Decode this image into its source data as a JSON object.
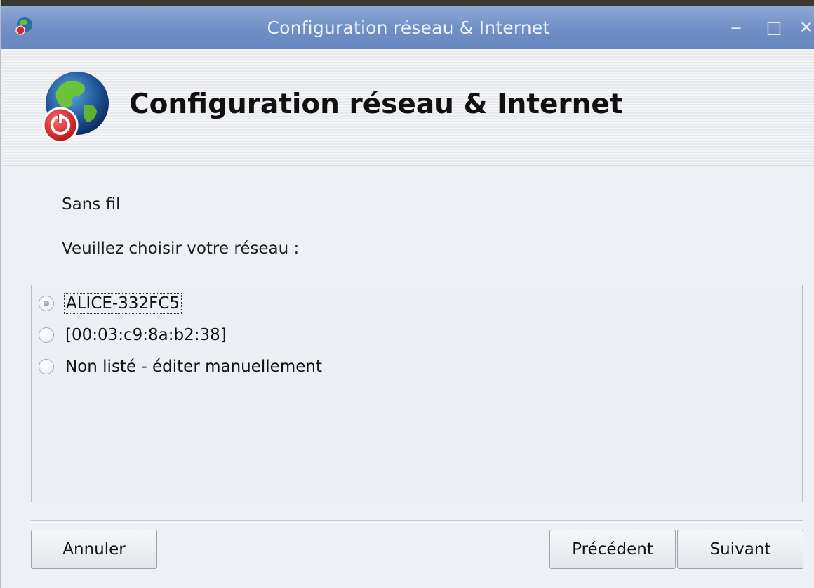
{
  "window": {
    "title": "Configuration réseau & Internet",
    "controls": {
      "minimize": "‒",
      "maximize": "□",
      "close": "✕"
    }
  },
  "header": {
    "heading": "Configuration réseau & Internet",
    "icon": "globe-network-icon"
  },
  "content": {
    "connection_type": "Sans fil",
    "prompt": "Veuillez choisir votre réseau :",
    "networks": [
      {
        "label": "ALICE-332FC5",
        "selected": true
      },
      {
        "label": "[00:03:c9:8a:b2:38]",
        "selected": false
      },
      {
        "label": "Non listé - éditer manuellement",
        "selected": false
      }
    ]
  },
  "buttons": {
    "cancel": "Annuler",
    "previous": "Précédent",
    "next": "Suivant"
  },
  "colors": {
    "titlebar": "#7a97cb",
    "background": "#edf0f5"
  }
}
